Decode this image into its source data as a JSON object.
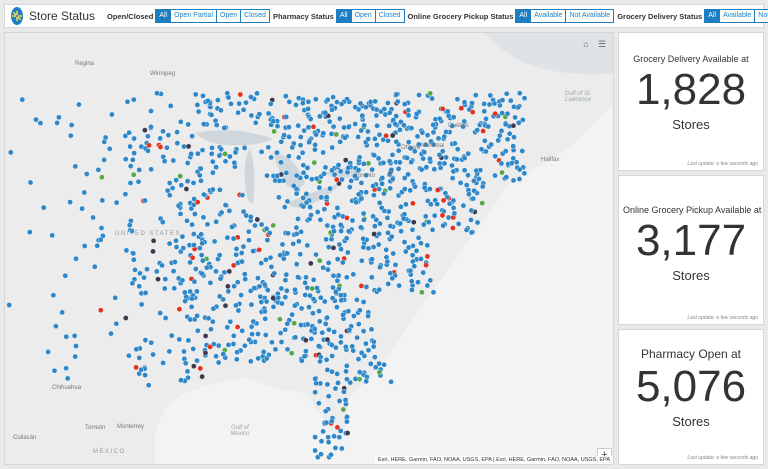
{
  "header": {
    "title": "Store Status",
    "filters": [
      {
        "label": "Open/Closed",
        "options": [
          "All",
          "Open Partial",
          "Open",
          "Closed"
        ],
        "selected": 0
      },
      {
        "label": "Pharmacy Status",
        "options": [
          "All",
          "Open",
          "Closed"
        ],
        "selected": 0
      },
      {
        "label": "Online Grocery Pickup Status",
        "options": [
          "All",
          "Available",
          "Not Available"
        ],
        "selected": 0
      },
      {
        "label": "Grocery Delivery Status",
        "options": [
          "All",
          "Available",
          "Not Available"
        ],
        "selected": 0
      }
    ]
  },
  "map": {
    "labels": {
      "regina": "Regina",
      "winnipeg": "Winnipeg",
      "quebec": "Québec",
      "ottawa": "Ottawa",
      "montreal": "Montréal",
      "toronto": "Toronto",
      "halifax": "Halifax",
      "united_states": "UNITED STATES",
      "gulf_st_lawrence": "Gulf of St. Lawrence",
      "chihuahua": "Chihuahua",
      "monterrey": "Monterrey",
      "torreon": "Torreón",
      "culiacan": "Culiacán",
      "mexico": "MÉXICO",
      "gulf_mexico": "Gulf of Mexico"
    },
    "attribution": "Esri, HERE, Garmin, FAO, NOAA, USGS, EPA | Esri, HERE, Garmin, FAO, NOAA, USGS, EPA",
    "zoom_in": "+",
    "zoom_out": "−",
    "colors": {
      "store": "#2d87c8",
      "red": "#e2331f",
      "dark": "#3d3a4e",
      "green": "#55a846"
    }
  },
  "cards": [
    {
      "title": "Grocery Delivery Available at",
      "value": "1,828",
      "unit": "Stores",
      "footer": "Last update: a few seconds ago"
    },
    {
      "title": "Online Grocery Pickup Available at",
      "value": "3,177",
      "unit": "Stores",
      "footer": "Last update: a few seconds ago"
    },
    {
      "title": "Pharmacy Open at",
      "value": "5,076",
      "unit": "Stores",
      "footer": "Last update: a few seconds ago"
    }
  ]
}
